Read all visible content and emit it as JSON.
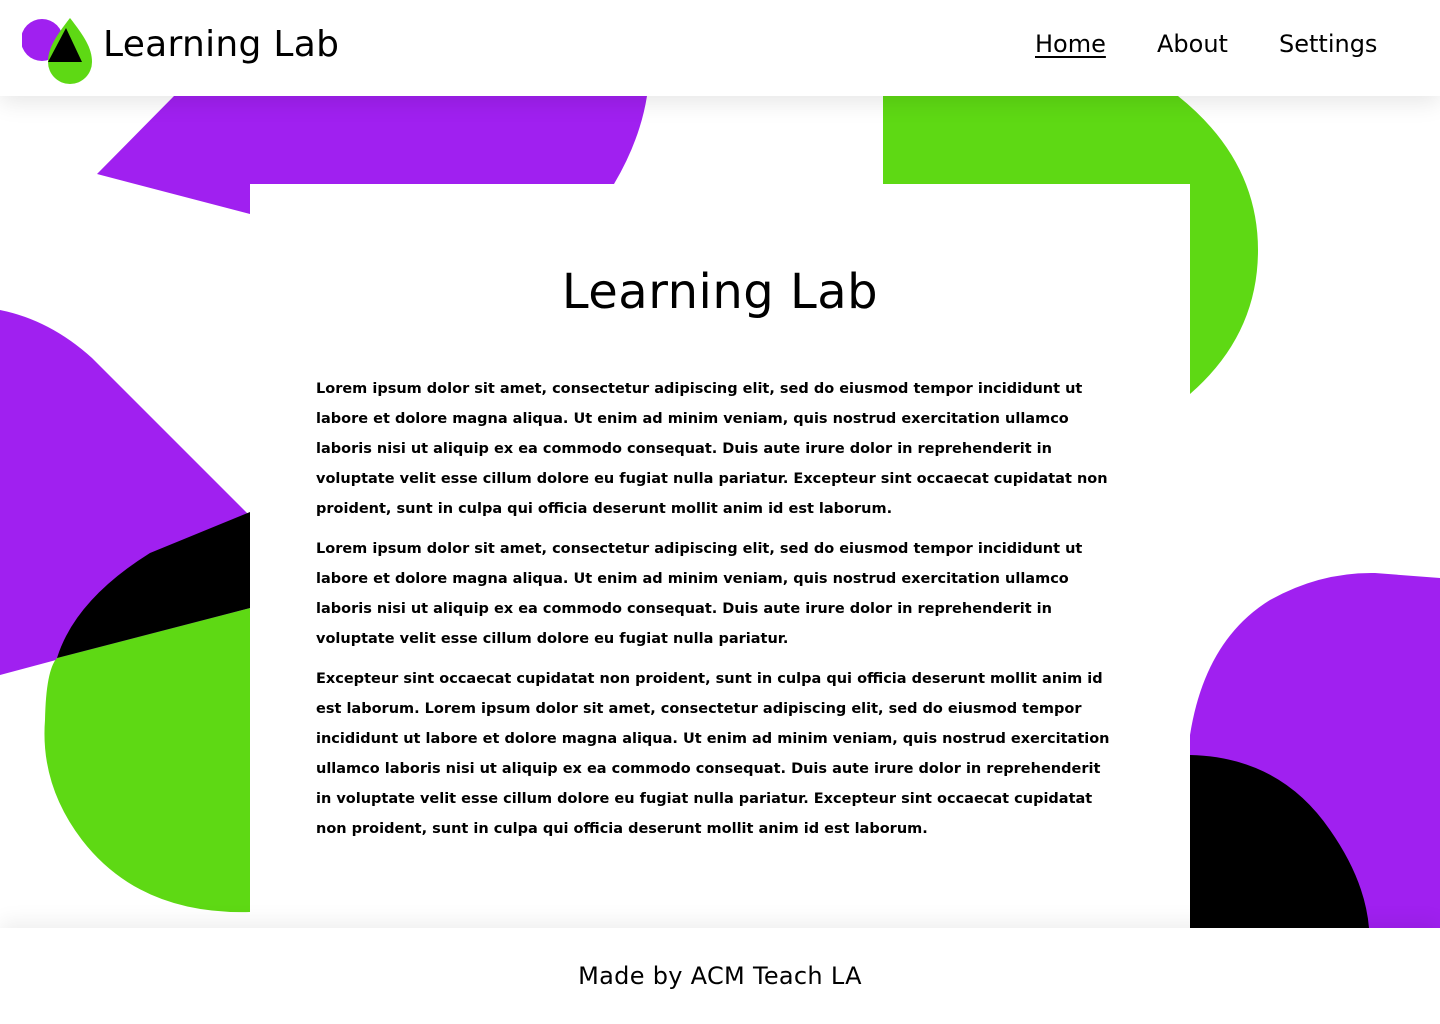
{
  "colors": {
    "purple": "#a020f0",
    "green": "#5ed914",
    "black": "#000000",
    "background": "#ffffff"
  },
  "header": {
    "logo_icon": "drop-circle-triangle-logo-icon",
    "brand": "Learning Lab",
    "nav": [
      {
        "label": "Home",
        "active": true
      },
      {
        "label": "About",
        "active": false
      },
      {
        "label": "Settings",
        "active": false
      }
    ]
  },
  "main": {
    "title": "Learning Lab",
    "paragraphs": [
      "Lorem ipsum dolor sit amet, consectetur adipiscing elit, sed do eiusmod tempor incididunt ut labore et dolore magna aliqua. Ut enim ad minim veniam, quis nostrud exercitation ullamco laboris nisi ut aliquip ex ea commodo consequat. Duis aute irure dolor in reprehenderit in voluptate velit esse cillum dolore eu fugiat nulla pariatur. Excepteur sint occaecat cupidatat non proident, sunt in culpa qui officia deserunt mollit anim id est laborum.",
      "Lorem ipsum dolor sit amet, consectetur adipiscing elit, sed do eiusmod tempor incididunt ut labore et dolore magna aliqua. Ut enim ad minim veniam, quis nostrud exercitation ullamco laboris nisi ut aliquip ex ea commodo consequat. Duis aute irure dolor in reprehenderit in voluptate velit esse cillum dolore eu fugiat nulla pariatur.",
      "Excepteur sint occaecat cupidatat non proident, sunt in culpa qui officia deserunt mollit anim id est laborum. Lorem ipsum dolor sit amet, consectetur adipiscing elit, sed do eiusmod tempor incididunt ut labore et dolore magna aliqua. Ut enim ad minim veniam, quis nostrud exercitation ullamco laboris nisi ut aliquip ex ea commodo consequat. Duis aute irure dolor in reprehenderit in voluptate velit esse cillum dolore eu fugiat nulla pariatur. Excepteur sint occaecat cupidatat non proident, sunt in culpa qui officia deserunt mollit anim id est laborum."
    ]
  },
  "footer": {
    "text": "Made by ACM Teach LA"
  }
}
